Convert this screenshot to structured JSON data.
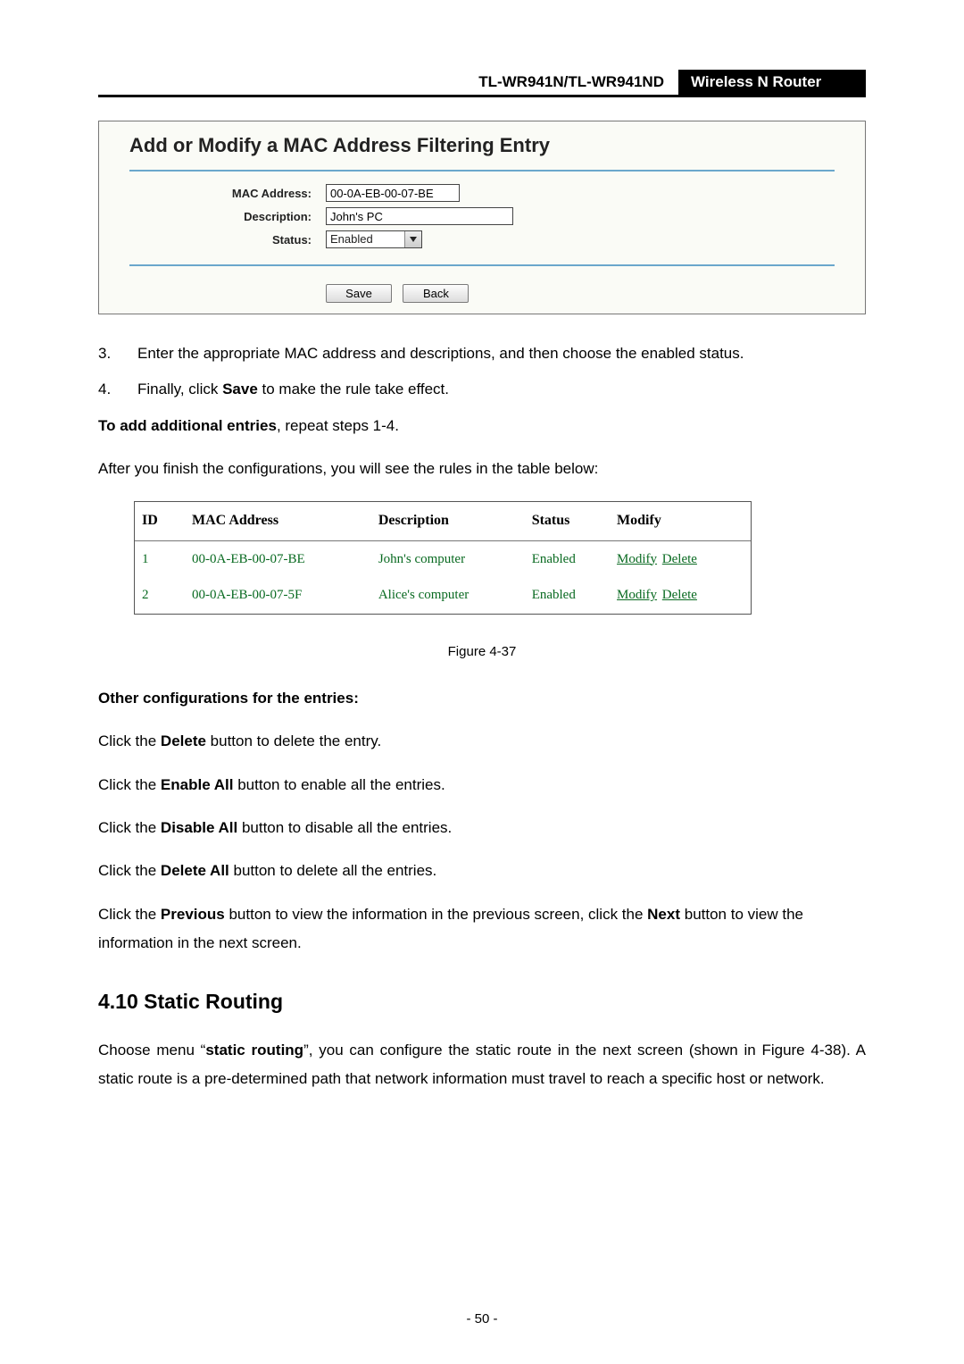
{
  "header": {
    "model": "TL-WR941N/TL-WR941ND",
    "product": "Wireless  N  Router"
  },
  "form": {
    "title": "Add or Modify a MAC Address Filtering Entry",
    "labels": {
      "mac": "MAC Address:",
      "desc": "Description:",
      "status": "Status:"
    },
    "values": {
      "mac": "00-0A-EB-00-07-BE",
      "desc": "John's PC",
      "status": "Enabled"
    },
    "buttons": {
      "save": "Save",
      "back": "Back"
    }
  },
  "steps": {
    "s3_num": "3.",
    "s3": "Enter the appropriate MAC address and descriptions, and then choose the enabled status.",
    "s4_num": "4.",
    "s4_a": "Finally, click ",
    "s4_b": "Save",
    "s4_c": " to make the rule take effect."
  },
  "additional": {
    "a1_bold": "To add additional entries",
    "a1_rest": ", repeat steps 1-4.",
    "a2": "After you finish the configurations, you will see the rules in the table below:"
  },
  "rules_table": {
    "headers": {
      "id": "ID",
      "mac": "MAC Address",
      "desc": "Description",
      "status": "Status",
      "modify": "Modify"
    },
    "rows": [
      {
        "id": "1",
        "mac": "00-0A-EB-00-07-BE",
        "desc": "John's computer",
        "status": "Enabled",
        "modify": "Modify",
        "delete": "Delete"
      },
      {
        "id": "2",
        "mac": "00-0A-EB-00-07-5F",
        "desc": "Alice's computer",
        "status": "Enabled",
        "modify": "Modify",
        "delete": "Delete"
      }
    ],
    "caption": "Figure 4-37"
  },
  "other": {
    "title": "Other configurations for the entries:",
    "l1_a": "Click the ",
    "l1_b": "Delete",
    "l1_c": " button to delete the entry.",
    "l2_a": "Click the ",
    "l2_b": "Enable All",
    "l2_c": " button to enable all the entries.",
    "l3_a": "Click the ",
    "l3_b": "Disable All",
    "l3_c": " button to disable all the entries.",
    "l4_a": "Click the ",
    "l4_b": "Delete All",
    "l4_c": " button to delete all the entries.",
    "l5_a": "Click the ",
    "l5_b": "Previous",
    "l5_c": " button to view the information in the previous screen, click the ",
    "l5_d": "Next",
    "l5_e": " button to view the information in the next screen."
  },
  "section": {
    "head": "4.10  Static Routing",
    "p_a": "Choose menu “",
    "p_b": "static routing",
    "p_c": "”, you can configure the static route in the next screen (shown in Figure 4-38). A static route is a pre-determined path that network information must travel to reach a specific host or network."
  },
  "page_number": "- 50 -"
}
